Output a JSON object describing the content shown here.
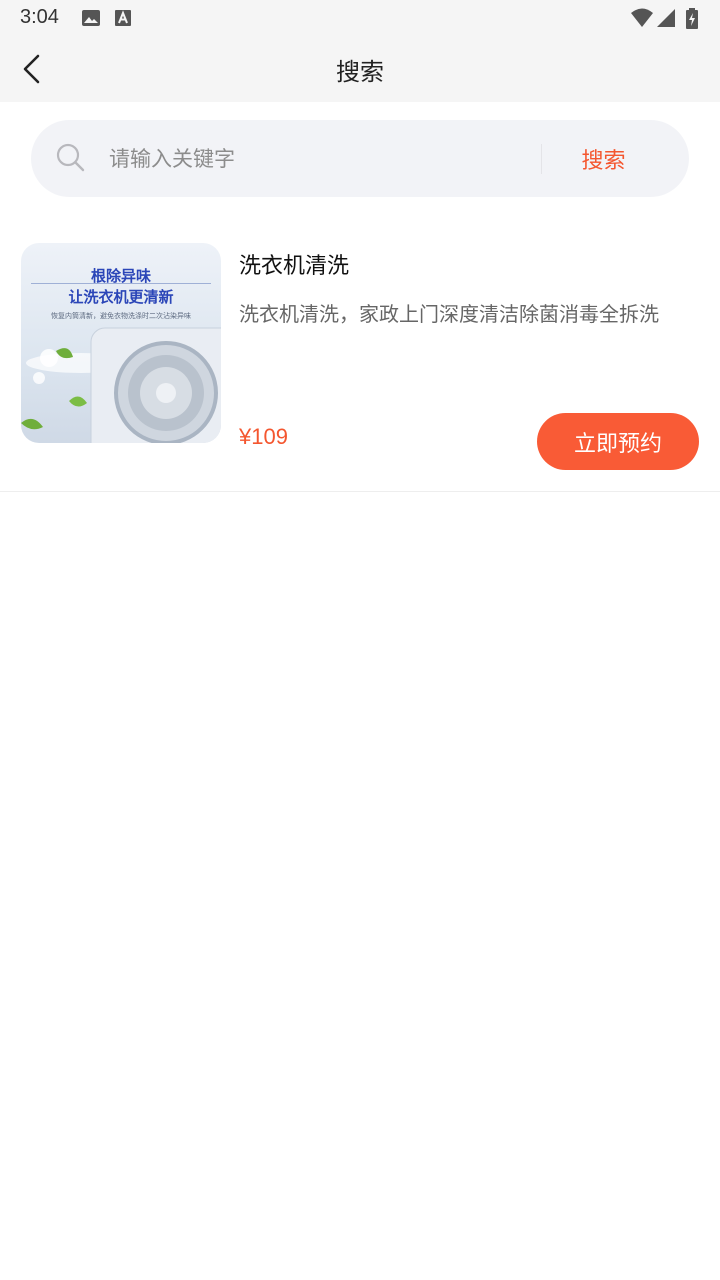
{
  "status_bar": {
    "time": "3:04",
    "left_icons": [
      "image-icon",
      "font-a-icon"
    ],
    "right_icons": [
      "wifi-icon",
      "signal-icon",
      "battery-charging-icon"
    ]
  },
  "nav": {
    "title": "搜索",
    "back_icon": "chevron-left-icon"
  },
  "search": {
    "placeholder": "请输入关键字",
    "value": "",
    "button_label": "搜索"
  },
  "results": [
    {
      "thumb_line1": "根除异味",
      "thumb_line2": "让洗衣机更清新",
      "thumb_line3": "恢复内筒清新，避免衣物洗涤时二次沾染异味",
      "title": "洗衣机清洗",
      "description": "洗衣机清洗，家政上门深度清洁除菌消毒全拆洗",
      "price": "¥109",
      "button_label": "立即预约"
    }
  ],
  "colors": {
    "accent": "#f95b36",
    "price": "#f4562f",
    "search_bg": "#f2f3f7",
    "header_bg": "#f5f5f5"
  }
}
